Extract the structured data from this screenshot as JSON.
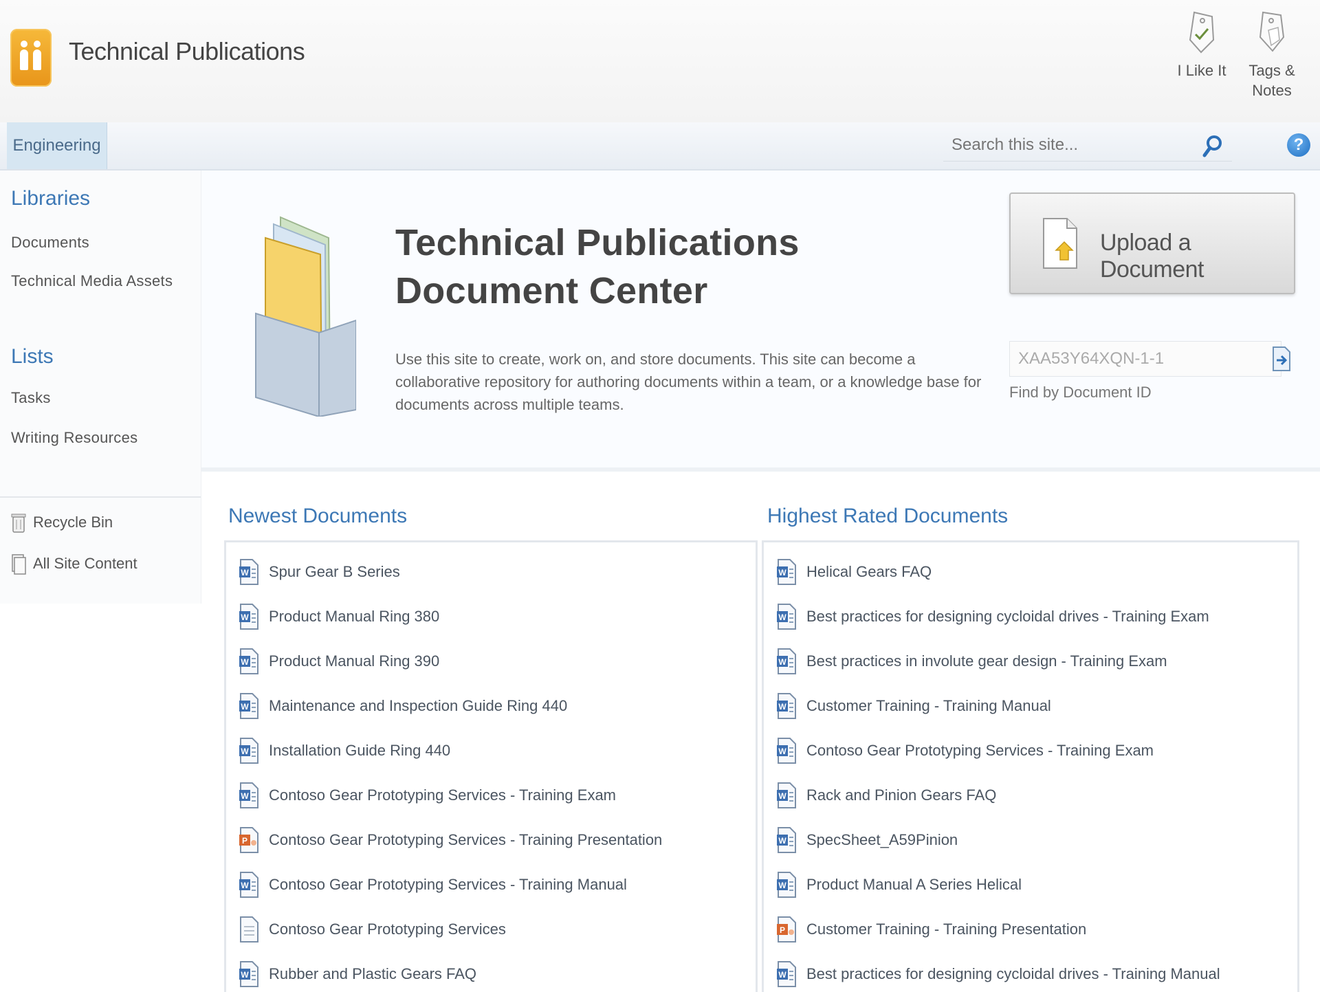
{
  "site": {
    "title": "Technical Publications"
  },
  "social": {
    "like_label": "I Like It",
    "tags_label": "Tags & Notes"
  },
  "nav": {
    "tab": "Engineering"
  },
  "search": {
    "placeholder": "Search this site..."
  },
  "leftnav": {
    "libraries_heading": "Libraries",
    "libraries": [
      "Documents",
      "Technical Media Assets"
    ],
    "lists_heading": "Lists",
    "lists": [
      "Tasks",
      "Writing Resources"
    ],
    "recycle_bin": "Recycle Bin",
    "all_site_content": "All Site Content"
  },
  "hero": {
    "title": "Technical Publications Document Center",
    "description": "Use this site to create, work on, and store documents. This site can become a collaborative repository for authoring documents within a team, or a knowledge base for documents across multiple teams.",
    "upload_label": "Upload a Document",
    "doc_id_value": "XAA53Y64XQN-1-1",
    "doc_id_label": "Find by Document ID"
  },
  "newest": {
    "title": "Newest Documents",
    "items": [
      {
        "label": "Spur Gear B Series",
        "icon": "word-doc-icon"
      },
      {
        "label": "Product Manual Ring 380",
        "icon": "word-doc-icon"
      },
      {
        "label": "Product Manual Ring 390",
        "icon": "word-doc-icon"
      },
      {
        "label": "Maintenance and Inspection Guide Ring 440",
        "icon": "word-doc-icon"
      },
      {
        "label": "Installation Guide Ring 440",
        "icon": "word-doc-icon"
      },
      {
        "label": "Contoso Gear Prototyping Services - Training Exam",
        "icon": "word-doc-icon"
      },
      {
        "label": "Contoso Gear Prototyping Services - Training Presentation",
        "icon": "powerpoint-icon"
      },
      {
        "label": "Contoso Gear Prototyping Services - Training Manual",
        "icon": "word-doc-icon"
      },
      {
        "label": "Contoso Gear Prototyping Services",
        "icon": "generic-doc-icon"
      },
      {
        "label": "Rubber and Plastic Gears FAQ",
        "icon": "word-doc-icon"
      }
    ]
  },
  "highest": {
    "title": "Highest Rated Documents",
    "items": [
      {
        "label": "Helical Gears FAQ",
        "icon": "word-doc-icon"
      },
      {
        "label": "Best practices for designing cycloidal drives - Training Exam",
        "icon": "word-doc-icon"
      },
      {
        "label": "Best practices in involute gear design - Training Exam",
        "icon": "word-doc-icon"
      },
      {
        "label": "Customer Training - Training Manual",
        "icon": "word-doc-icon"
      },
      {
        "label": "Contoso Gear Prototyping Services - Training Exam",
        "icon": "word-doc-icon"
      },
      {
        "label": "Rack and Pinion Gears FAQ",
        "icon": "word-doc-icon"
      },
      {
        "label": "SpecSheet_A59Pinion",
        "icon": "word-doc-icon"
      },
      {
        "label": "Product Manual A Series Helical",
        "icon": "word-doc-icon"
      },
      {
        "label": "Customer Training - Training Presentation",
        "icon": "powerpoint-icon"
      },
      {
        "label": "Best practices for designing cycloidal drives - Training Manual",
        "icon": "word-doc-icon"
      }
    ]
  }
}
